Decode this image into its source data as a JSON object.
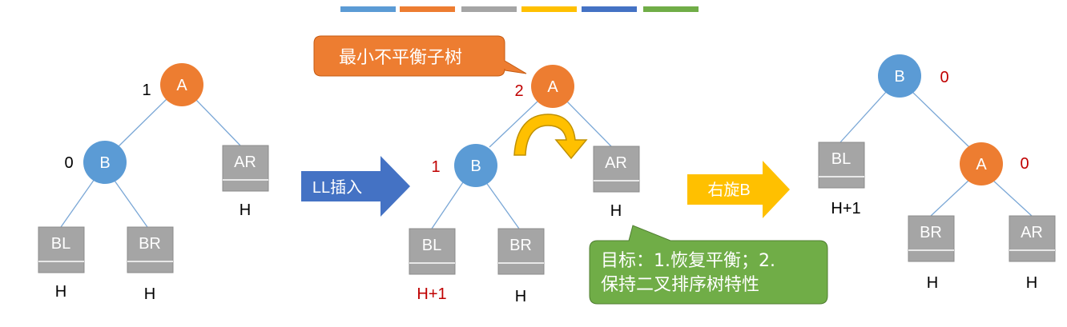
{
  "colors": {
    "palette": [
      "#5b9bd5",
      "#ed7d31",
      "#a5a5a5",
      "#ffc000",
      "#4472c4",
      "#70ad47"
    ],
    "orange_node": "#ed7d31",
    "blue_node": "#5b9bd5",
    "subtree_box": "#a5a5a5",
    "edge": "#7aa7d6",
    "balance_dark": "#000000",
    "balance_red": "#c00000",
    "ll_arrow": "#4472c4",
    "rotate_arrow": "#ffc000",
    "curved_arrow": "#bf9000",
    "callout_top": "#ed7d31",
    "callout_bottom": "#70ad47"
  },
  "tree1": {
    "A": {
      "label": "A",
      "balance": "1"
    },
    "B": {
      "label": "B",
      "balance": "0"
    },
    "BL": {
      "label": "BL",
      "height": "H"
    },
    "BR": {
      "label": "BR",
      "height": "H"
    },
    "AR": {
      "label": "AR",
      "height": "H"
    }
  },
  "tree2": {
    "A": {
      "label": "A",
      "balance": "2"
    },
    "B": {
      "label": "B",
      "balance": "1"
    },
    "BL": {
      "label": "BL",
      "height": "H+1"
    },
    "BR": {
      "label": "BR",
      "height": "H"
    },
    "AR": {
      "label": "AR",
      "height": "H"
    }
  },
  "tree3": {
    "B": {
      "label": "B",
      "balance": "0"
    },
    "A": {
      "label": "A",
      "balance": "0"
    },
    "BL": {
      "label": "BL",
      "height": "H+1"
    },
    "BR": {
      "label": "BR",
      "height": "H"
    },
    "AR": {
      "label": "AR",
      "height": "H"
    }
  },
  "arrows": {
    "ll_insert": "LL插入",
    "rotate_right": "右旋B"
  },
  "callouts": {
    "min_unbalanced": "最小不平衡子树",
    "goal_line1": "目标：1.恢复平衡；2.",
    "goal_line2": "保持二叉排序树特性"
  }
}
